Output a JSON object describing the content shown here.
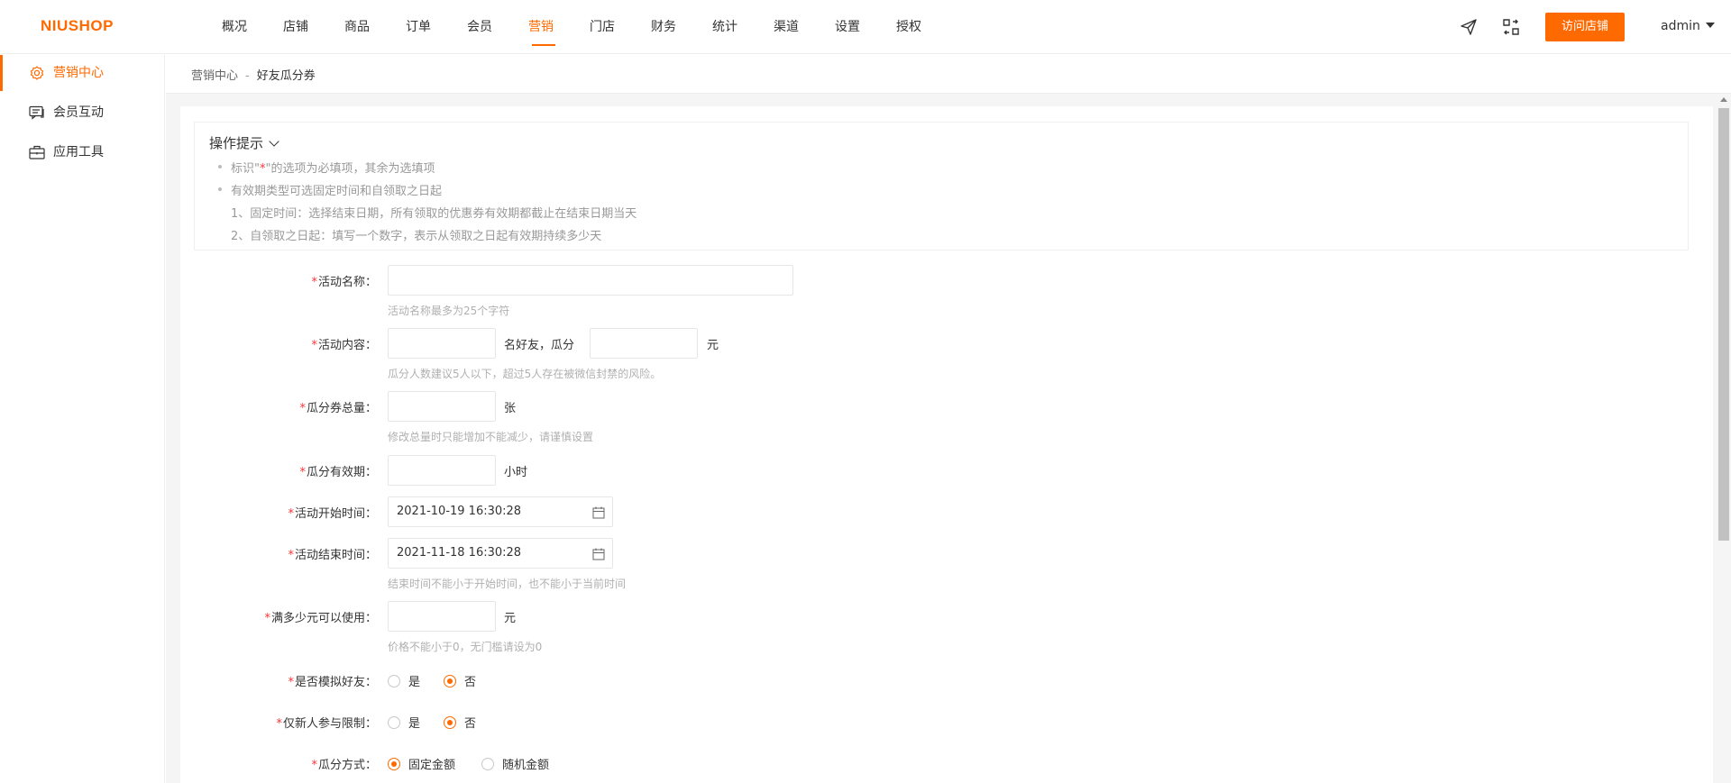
{
  "header": {
    "logo": "NIUSHOP",
    "nav": [
      {
        "label": "概况"
      },
      {
        "label": "店铺"
      },
      {
        "label": "商品"
      },
      {
        "label": "订单"
      },
      {
        "label": "会员"
      },
      {
        "label": "营销"
      },
      {
        "label": "门店"
      },
      {
        "label": "财务"
      },
      {
        "label": "统计"
      },
      {
        "label": "渠道"
      },
      {
        "label": "设置"
      },
      {
        "label": "授权"
      }
    ],
    "active_nav": "营销",
    "visit_store": "访问店铺",
    "user": "admin",
    "accent_color": "#ff6a00"
  },
  "sidebar": {
    "items": [
      {
        "label": "营销中心",
        "icon": "gear-icon"
      },
      {
        "label": "会员互动",
        "icon": "chat-icon"
      },
      {
        "label": "应用工具",
        "icon": "briefcase-icon"
      }
    ]
  },
  "breadcrumb": {
    "parent": "营销中心",
    "separator": "-",
    "current": "好友瓜分券"
  },
  "tips": {
    "title": "操作提示",
    "line1_prefix": "标识\"",
    "line1_star": "*",
    "line1_suffix": "\"的选项为必填项，其余为选填项",
    "line2": "有效期类型可选固定时间和自领取之日起",
    "line3": "1、固定时间：选择结束日期，所有领取的优惠券有效期都截止在结束日期当天",
    "line4": "2、自领取之日起：填写一个数字，表示从领取之日起有效期持续多少天"
  },
  "form": {
    "required_mark": "*",
    "name": {
      "label": "活动名称：",
      "value": "",
      "hint": "活动名称最多为25个字符"
    },
    "content": {
      "label": "活动内容：",
      "mid_text": "名好友，瓜分",
      "unit": "元",
      "people": "",
      "amount": "",
      "hint": "瓜分人数建议5人以下，超过5人存在被微信封禁的风险。"
    },
    "total": {
      "label": "瓜分券总量：",
      "unit": "张",
      "value": "",
      "hint": "修改总量时只能增加不能减少，请谨慎设置"
    },
    "validity": {
      "label": "瓜分有效期：",
      "unit": "小时",
      "value": ""
    },
    "start_time": {
      "label": "活动开始时间：",
      "value": "2021-10-19 16:30:28"
    },
    "end_time": {
      "label": "活动结束时间：",
      "value": "2021-11-18 16:30:28",
      "hint": "结束时间不能小于开始时间，也不能小于当前时间"
    },
    "threshold": {
      "label": "满多少元可以使用：",
      "unit": "元",
      "value": "",
      "hint": "价格不能小于0，无门槛请设为0"
    },
    "simulate": {
      "label": "是否模拟好友：",
      "options": [
        "是",
        "否"
      ],
      "selected": "否"
    },
    "newcomer": {
      "label": "仅新人参与限制：",
      "options": [
        "是",
        "否"
      ],
      "selected": "否"
    },
    "split_mode": {
      "label": "瓜分方式：",
      "options": [
        "固定金额",
        "随机金额"
      ],
      "selected": "固定金额"
    }
  }
}
